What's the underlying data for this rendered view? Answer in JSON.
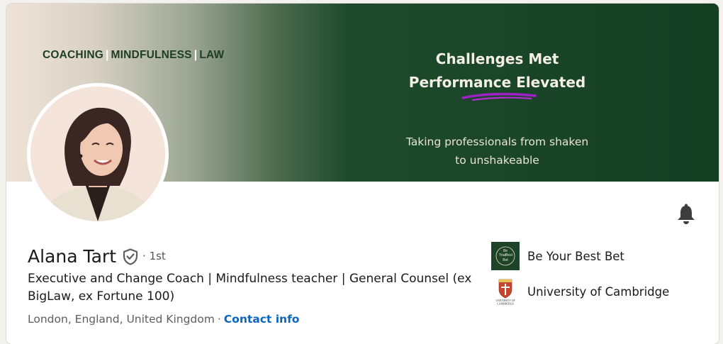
{
  "banner": {
    "tagline_parts": [
      "COACHING",
      "MINDFULNESS",
      "LAW"
    ],
    "tagline_separator": "|",
    "heading_line1": "Challenges Met",
    "heading_line2": "Performance Elevated",
    "subtitle_line1": "Taking professionals from shaken",
    "subtitle_line2": "to unshakeable",
    "accent_color": "#a020c8",
    "dark_green": "#153f24"
  },
  "profile": {
    "name": "Alana Tart",
    "verified_icon": "shield-check-icon",
    "degree_separator": "·",
    "degree": "1st",
    "headline": "Executive and Change Coach | Mindfulness teacher | General Counsel (ex BigLaw, ex Fortune 100)",
    "location": "London, England, United Kingdom",
    "location_separator": "·",
    "contact_label": "Contact info",
    "link_color": "#0a66c2"
  },
  "notifications": {
    "icon": "bell-icon"
  },
  "organizations": [
    {
      "name": "Be Your Best Bet",
      "logo_text_lines": [
        "Be",
        "Your",
        "Best",
        "Bet"
      ]
    },
    {
      "name": "University of Cambridge",
      "logo_text_lines": [
        "UNIVERSITY OF",
        "CAMBRIDGE"
      ]
    }
  ]
}
